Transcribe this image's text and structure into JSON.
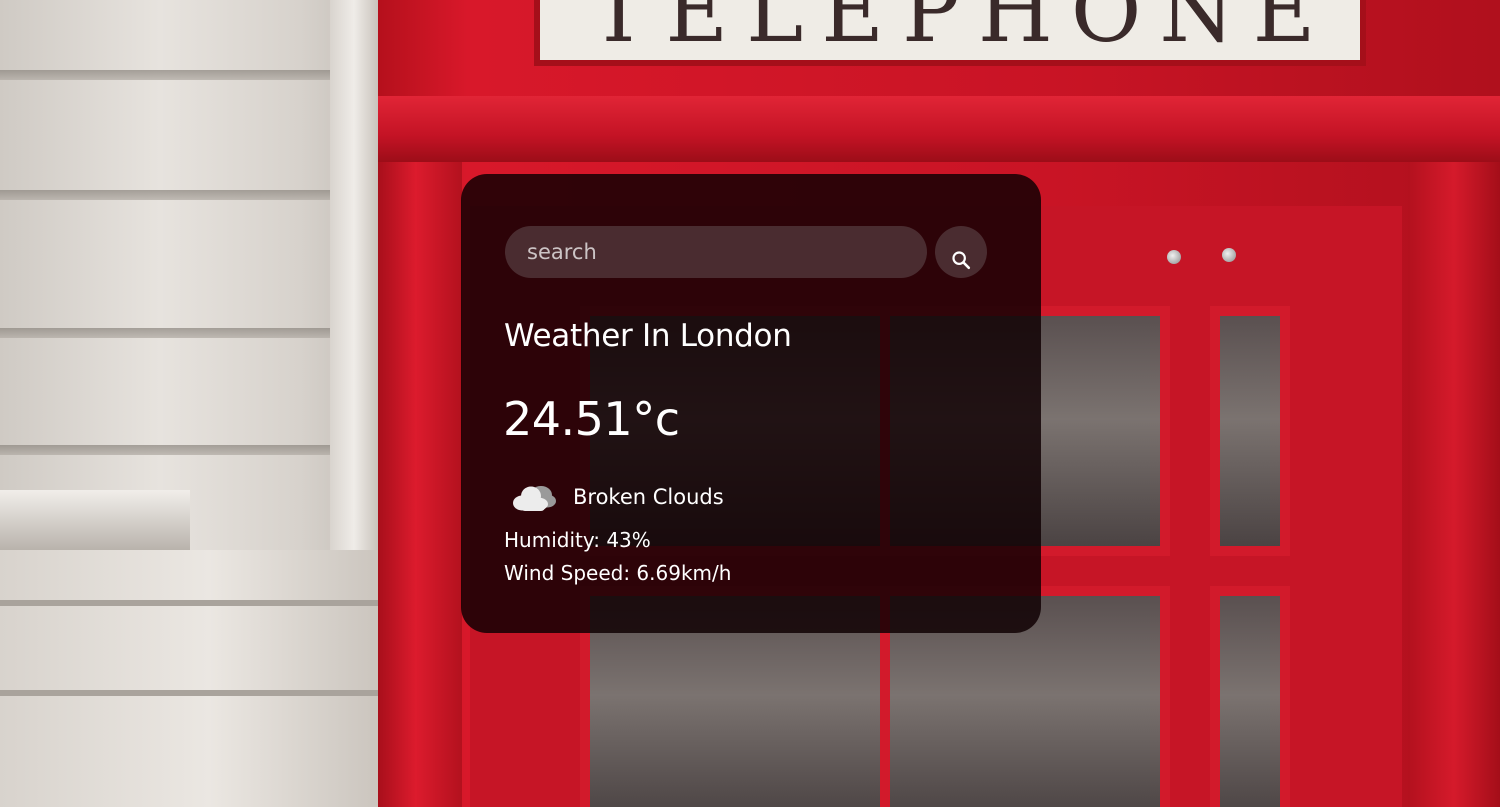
{
  "background": {
    "sign_text": "TELEPHONE"
  },
  "search": {
    "placeholder": "search",
    "value": "",
    "button_icon": "search-icon"
  },
  "weather": {
    "city_heading": "Weather In London",
    "temperature": "24.51°c",
    "condition_icon": "broken-clouds-icon",
    "description": "Broken Clouds",
    "humidity": "Humidity: 43%",
    "wind": "Wind Speed: 6.69km/h"
  },
  "colors": {
    "card_background": "#100002",
    "booth_red": "#c91425",
    "text": "#ffffff"
  }
}
